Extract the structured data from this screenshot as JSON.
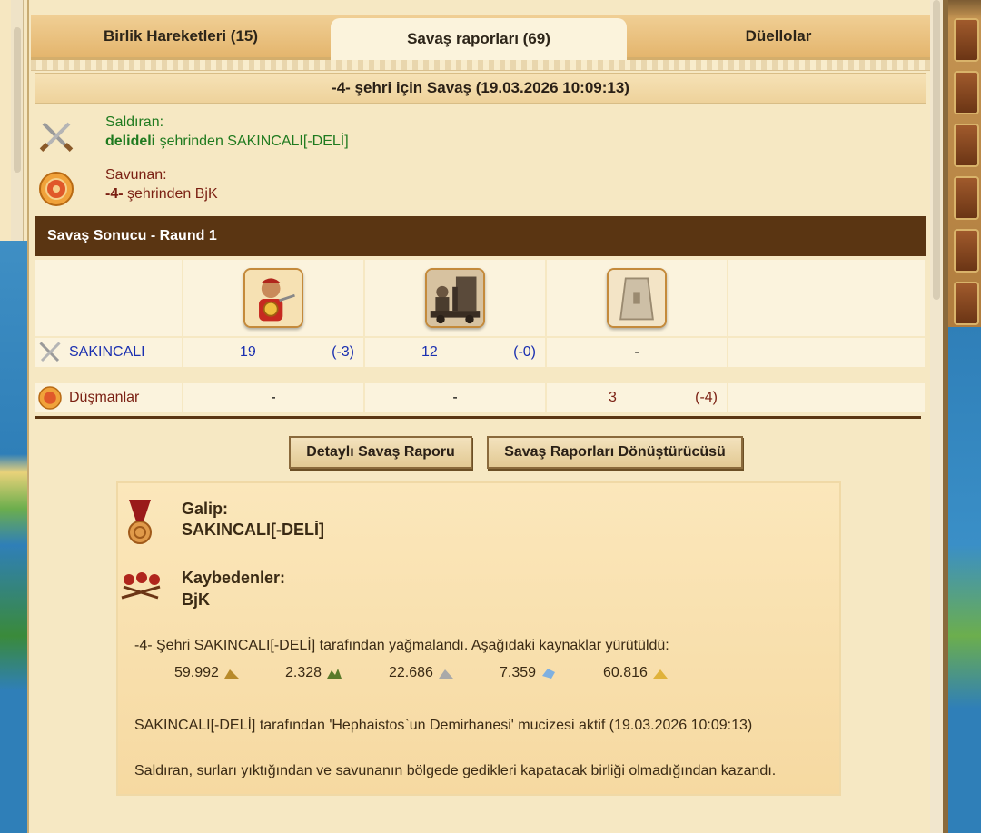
{
  "tabs": [
    {
      "label": "Birlik Hareketleri (15)"
    },
    {
      "label": "Savaş raporları (69)"
    },
    {
      "label": "Düellolar"
    }
  ],
  "report": {
    "title": "-4- şehri için Savaş (19.03.2026 10:09:13)",
    "attacker_label": "Saldıran:",
    "attacker_city": "delideli",
    "attacker_rest": " şehrinden SAKINCALI[-DELİ]",
    "defender_label": "Savunan:",
    "defender_city": "-4-",
    "defender_rest": " şehrinden BjK",
    "round_title": "Savaş Sonucu - Raund 1"
  },
  "table": {
    "units": [
      "warrior-unit",
      "siege-unit",
      "wall-unit"
    ],
    "attacker_row": {
      "name": "SAKINCALI",
      "u1": "19",
      "u1_loss": "(-3)",
      "u2": "12",
      "u2_loss": "(-0)",
      "u3": "-"
    },
    "defender_row": {
      "name": "Düşmanlar",
      "u1": "-",
      "u2": "-",
      "u3": "3",
      "u3_loss": "(-4)"
    }
  },
  "buttons": {
    "detail": "Detaylı Savaş Raporu",
    "converter": "Savaş Raporları Dönüştürücüsü"
  },
  "result": {
    "winner_label": "Galip:",
    "winner": "SAKINCALI[-DELİ]",
    "losers_label": "Kaybedenler:",
    "losers": "BjK",
    "plunder_text": "-4- Şehri SAKINCALI[-DELİ] tarafından yağmalandı. Aşağıdaki kaynaklar yürütüldü:",
    "resources": [
      {
        "value": "59.992",
        "icon": "gold-icon"
      },
      {
        "value": "2.328",
        "icon": "wood-icon"
      },
      {
        "value": "22.686",
        "icon": "marble-icon"
      },
      {
        "value": "7.359",
        "icon": "crystal-icon"
      },
      {
        "value": "60.816",
        "icon": "sulfur-icon"
      }
    ],
    "wonder_text": "SAKINCALI[-DELİ] tarafından 'Hephaistos`un Demirhanesi' mucizesi aktif (19.03.2026 10:09:13)",
    "outcome_text": "Saldıran, surları yıktığından ve savunanın bölgede gedikleri kapatacak birliği olmadığından kazandı."
  },
  "colors": {
    "accent_dark": "#5a3512",
    "attacker_green": "#1f7a1f",
    "defender_red": "#7a1f12",
    "link_blue": "#1a2fb0"
  }
}
